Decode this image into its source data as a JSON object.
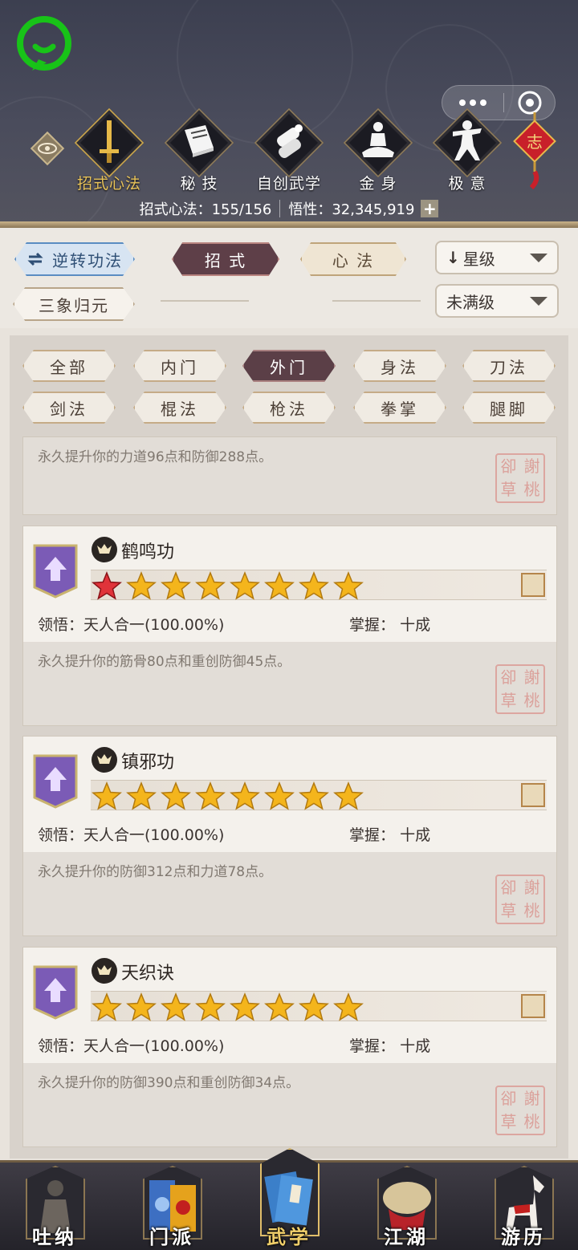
{
  "header": {
    "tabs": [
      {
        "label": "招式心法",
        "icon": "sword-icon",
        "active": true
      },
      {
        "label": "秘 技",
        "icon": "book-icon",
        "active": false
      },
      {
        "label": "自创武学",
        "icon": "scroll-icon",
        "active": false
      },
      {
        "label": "金 身",
        "icon": "meditation-icon",
        "active": false
      },
      {
        "label": "极 意",
        "icon": "fighter-icon",
        "active": false
      }
    ],
    "tassel_char": "志",
    "stats": {
      "skill_count_label": "招式心法：155/156",
      "insight_label": "悟性：32,345,919",
      "plus": "+"
    }
  },
  "controls": {
    "reverse_button": "逆转功法",
    "tab_moves": "招 式",
    "tab_methods": "心 法",
    "sort_dropdown": "星级",
    "sort_arrow": "↓",
    "merge_button": "三象归元",
    "level_dropdown": "未满级"
  },
  "filters": [
    "全部",
    "内门",
    "外门",
    "身法",
    "刀法",
    "剑法",
    "棍法",
    "枪法",
    "拳掌",
    "腿脚"
  ],
  "selected_filter": "外门",
  "skills_partial": {
    "desc": "永久提升你的力道96点和防御288点。"
  },
  "skills": [
    {
      "name": "鹤鸣功",
      "red_first_star": true,
      "star_count": 8,
      "insight_label": "领悟：",
      "insight_value": "天人合一(100.00%)",
      "mastery_label": "掌握：",
      "mastery_value": "十成",
      "desc": "永久提升你的筋骨80点和重创防御45点。"
    },
    {
      "name": "镇邪功",
      "red_first_star": false,
      "star_count": 8,
      "insight_label": "领悟：",
      "insight_value": "天人合一(100.00%)",
      "mastery_label": "掌握：",
      "mastery_value": "十成",
      "desc": "永久提升你的防御312点和力道78点。"
    },
    {
      "name": "天织诀",
      "red_first_star": false,
      "star_count": 8,
      "insight_label": "领悟：",
      "insight_value": "天人合一(100.00%)",
      "mastery_label": "掌握：",
      "mastery_value": "十成",
      "desc": "永久提升你的防御390点和重创防御34点。"
    }
  ],
  "seal_chars": [
    "卻",
    "謝",
    "草",
    "桃"
  ],
  "bottom_nav": [
    {
      "label": "吐纳",
      "icon": "monk-icon",
      "active": false
    },
    {
      "label": "门派",
      "icon": "sect-flags-icon",
      "active": false
    },
    {
      "label": "武学",
      "icon": "manual-books-icon",
      "active": true
    },
    {
      "label": "江湖",
      "icon": "straw-hat-icon",
      "active": false
    },
    {
      "label": "游历",
      "icon": "horse-icon",
      "active": false
    }
  ],
  "colors": {
    "accent_gold": "#e8c35a",
    "selected_tab": "#5e3f48",
    "star_gold": "#f4b51c",
    "star_red": "#e0333a",
    "badge_purple": "#7b5bb6"
  }
}
